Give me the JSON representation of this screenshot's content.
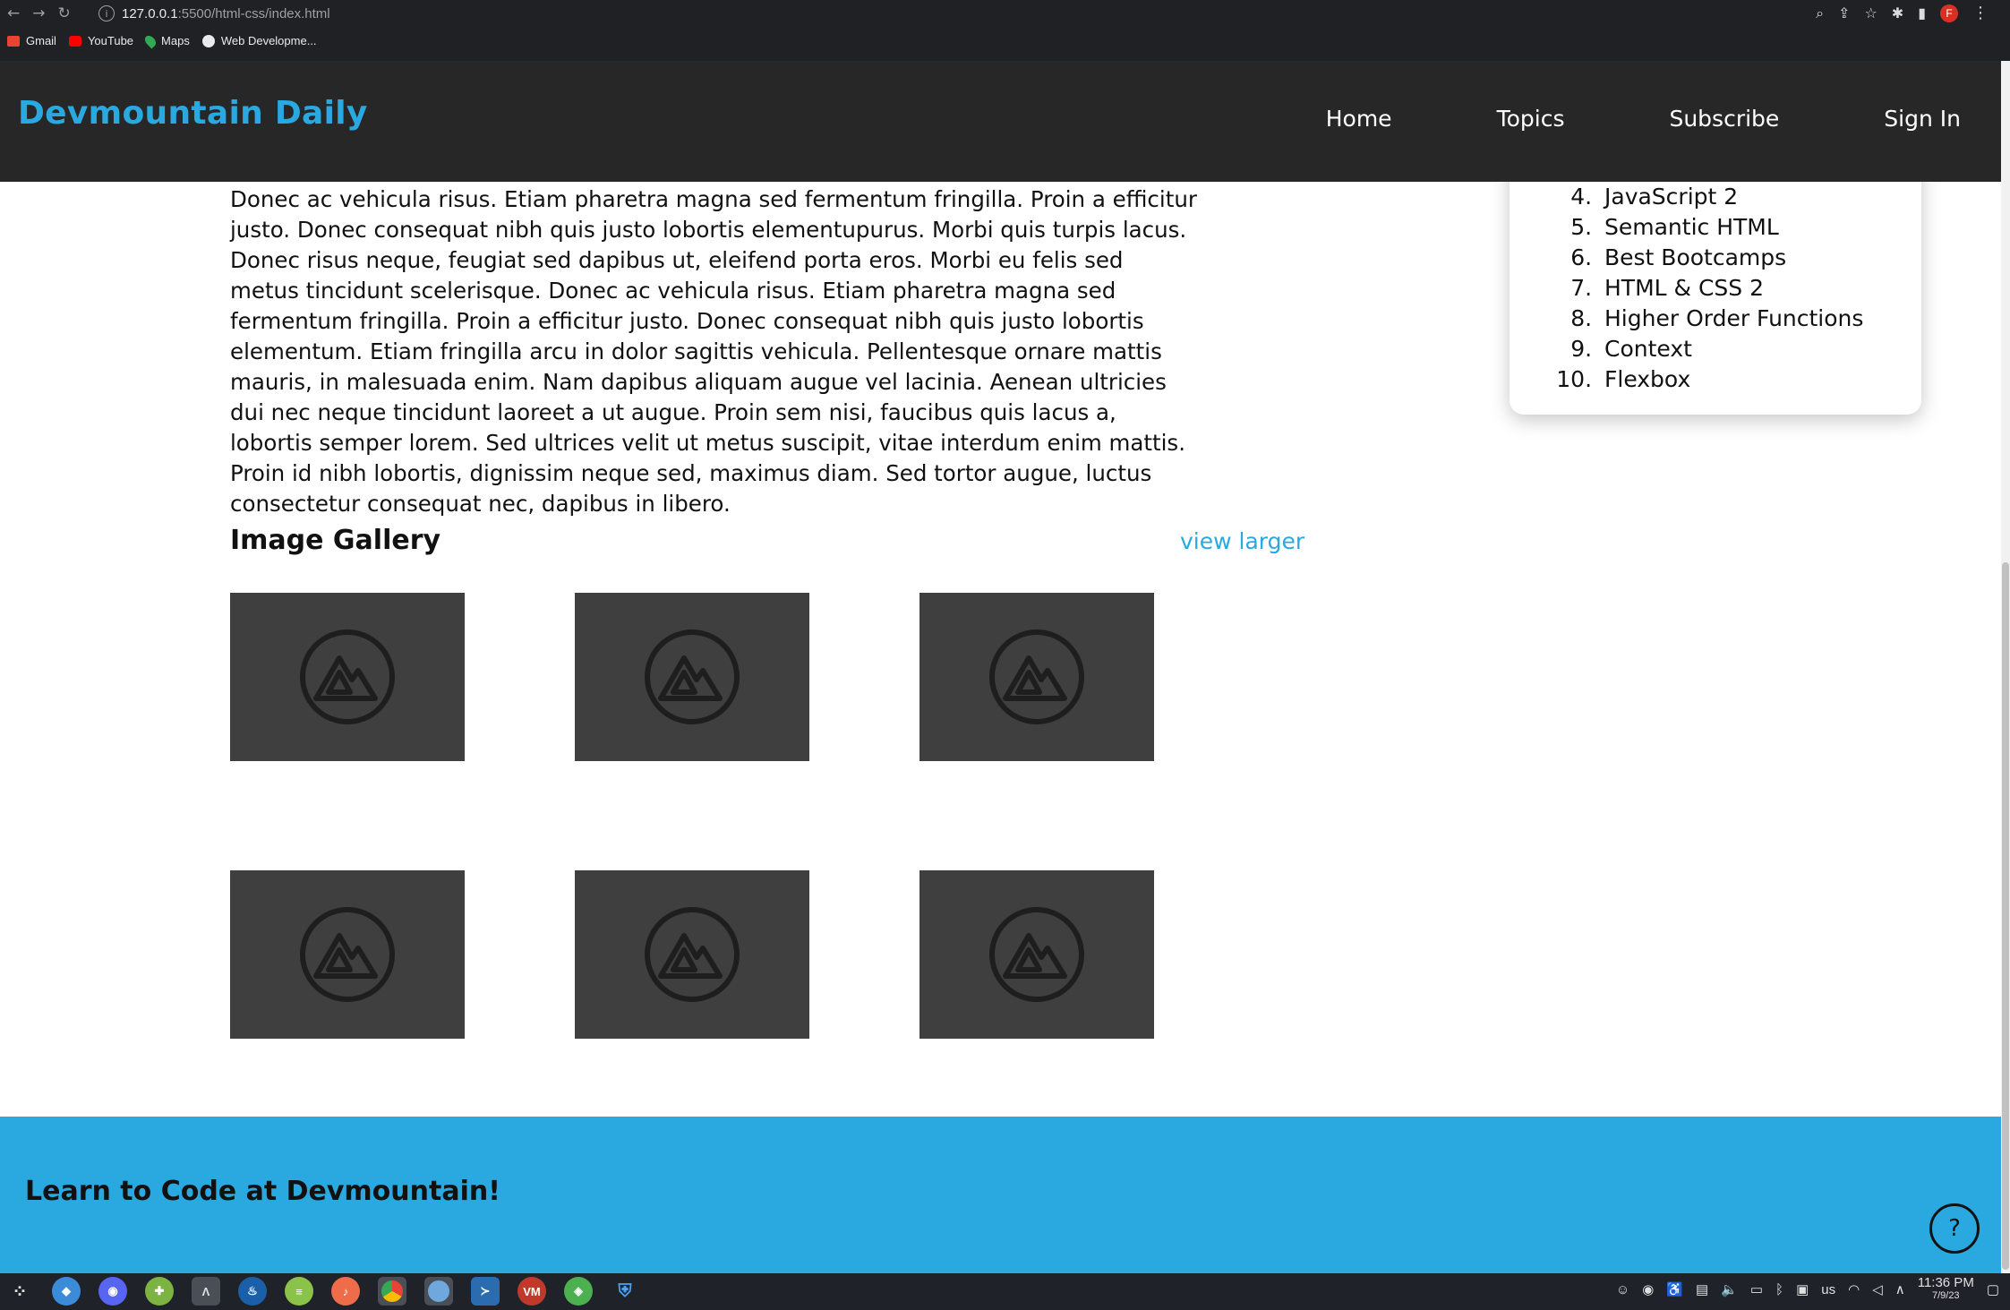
{
  "browser": {
    "url_host": "127.0.0.1",
    "url_rest": ":5500/html-css/index.html",
    "profile_initial": "F",
    "bookmarks": [
      "Gmail",
      "YouTube",
      "Maps",
      "Web Developme..."
    ]
  },
  "header": {
    "brand": "Devmountain Daily",
    "nav": [
      "Home",
      "Topics",
      "Subscribe",
      "Sign In"
    ]
  },
  "article": {
    "text": "Donec ac vehicula risus. Etiam pharetra magna sed fermentum fringilla. Proin a efficitur justo. Donec consequat nibh quis justo lobortis elementupurus. Morbi quis turpis lacus. Donec risus neque, feugiat sed dapibus ut, eleifend porta eros. Morbi eu felis sed metus tincidunt scelerisque. Donec ac vehicula risus. Etiam pharetra magna sed fermentum fringilla. Proin a efficitur justo. Donec consequat nibh quis justo lobortis elementum. Etiam fringilla arcu in dolor sagittis vehicula. Pellentesque ornare mattis mauris, in malesuada enim. Nam dapibus aliquam augue vel lacinia. Aenean ultricies dui nec neque tincidunt laoreet a ut augue. Proin sem nisi, faucibus quis lacus a, lobortis semper lorem. Sed ultrices velit ut metus suscipit, vitae interdum enim mattis. Proin id nibh lobortis, dignissim neque sed, maximus diam. Sed tortor augue, luctus consectetur consequat nec, dapibus in libero."
  },
  "sidebar": {
    "start": 4,
    "topics": [
      "JavaScript 2",
      "Semantic HTML",
      "Best Bootcamps",
      "HTML & CSS 2",
      "Higher Order Functions",
      "Context",
      "Flexbox"
    ]
  },
  "gallery": {
    "title": "Image Gallery",
    "view_larger": "view larger",
    "image_count": 6
  },
  "footer": {
    "text": "Learn to Code at Devmountain!",
    "help": "?"
  },
  "taskbar": {
    "keyboard": "us",
    "time": "11:36 PM",
    "date": "7/9/23",
    "apps": [
      "VM"
    ]
  }
}
